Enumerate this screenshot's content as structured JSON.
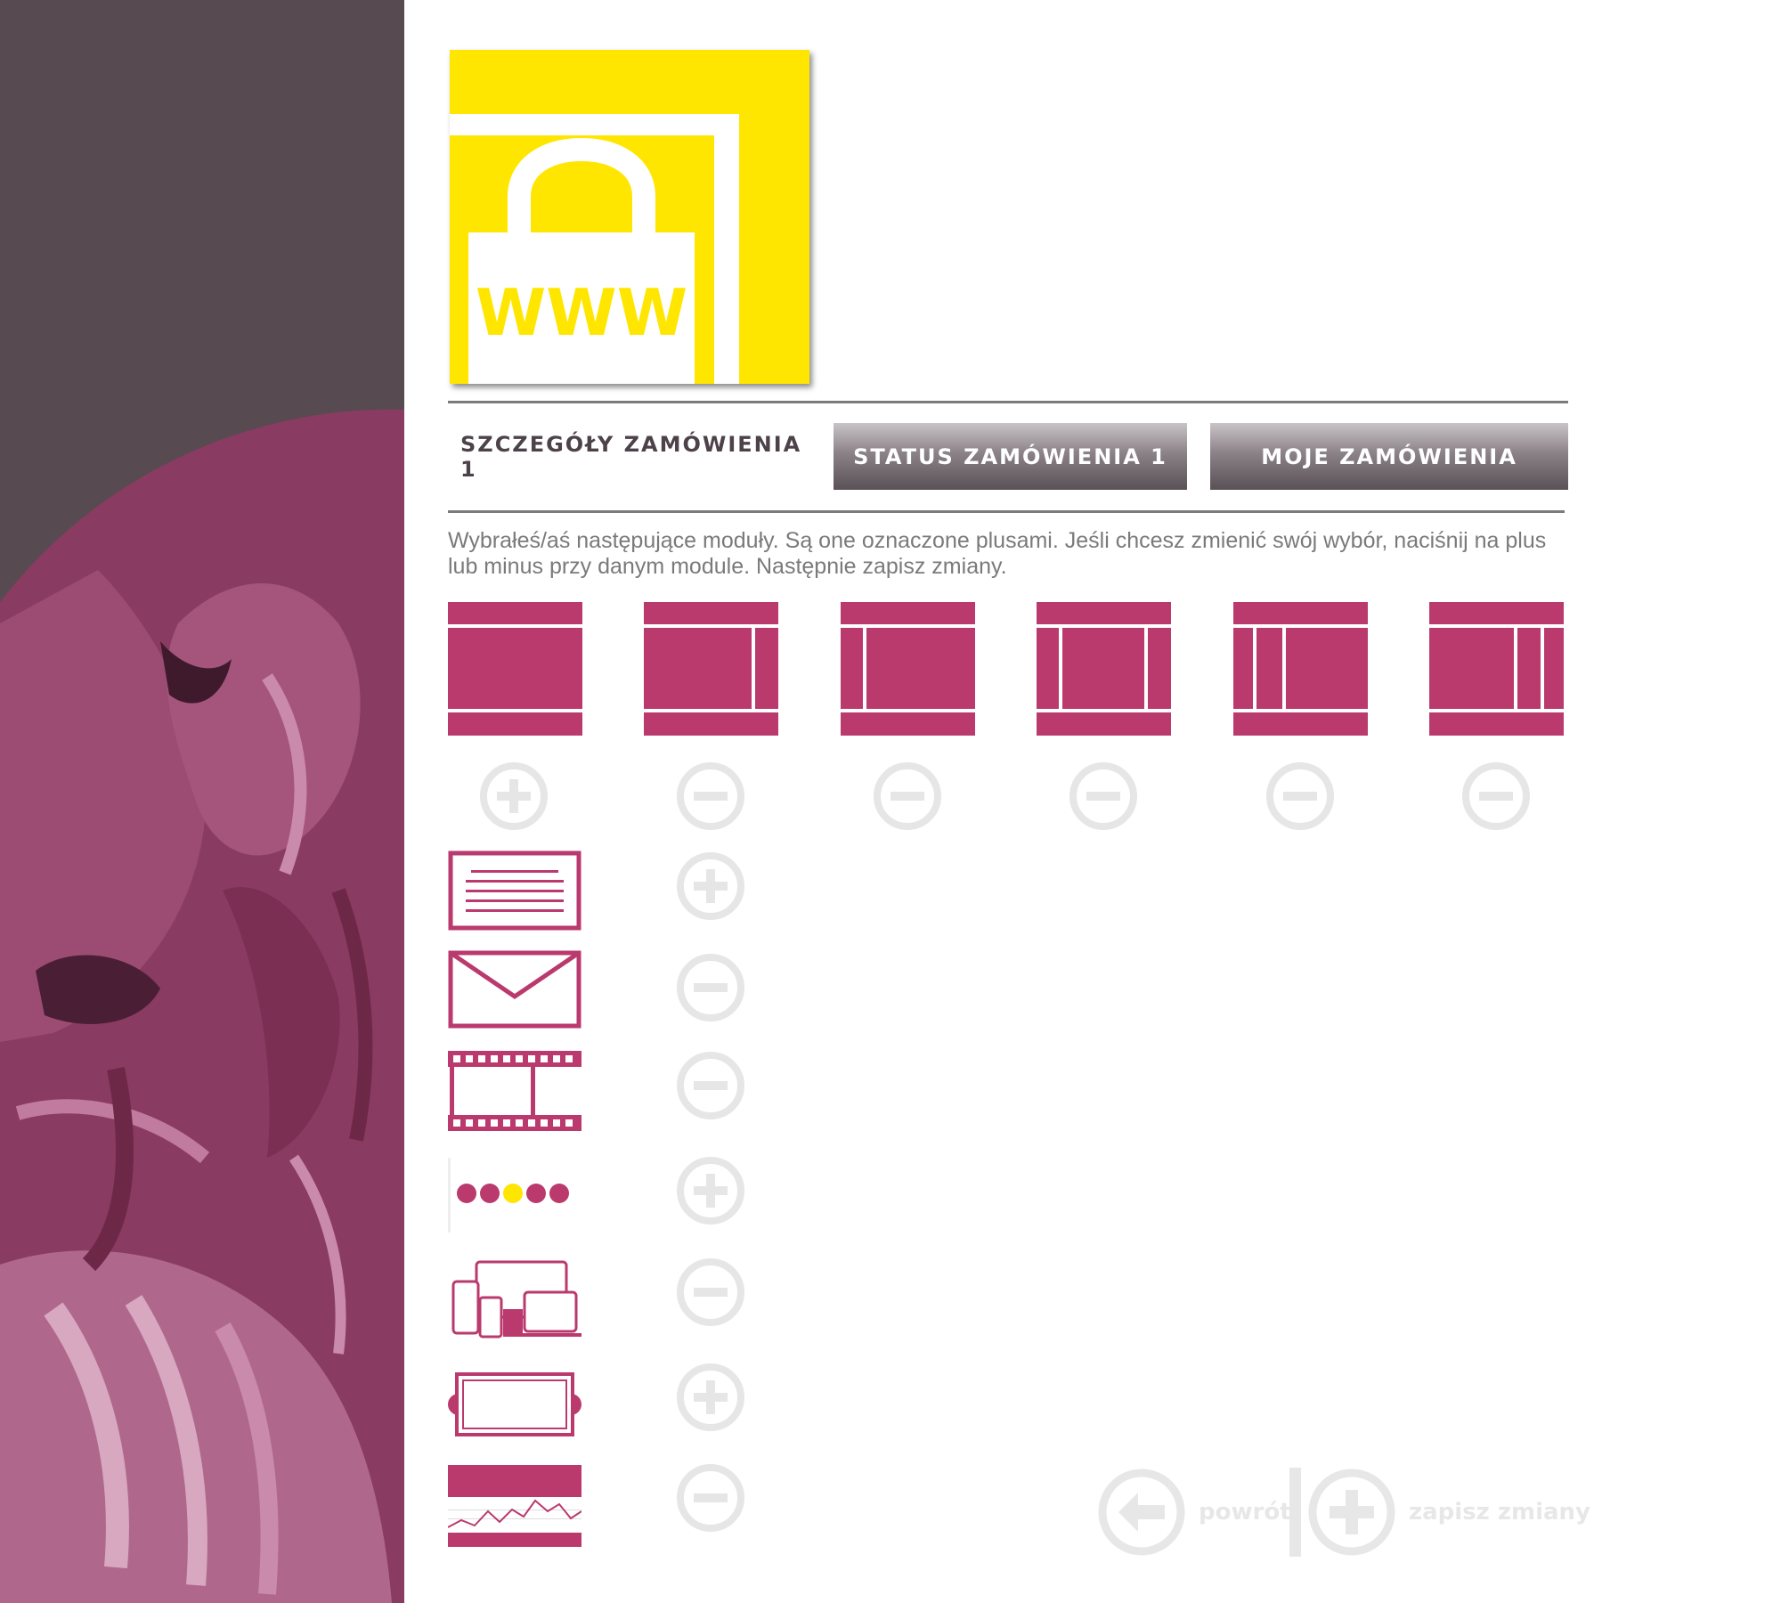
{
  "colors": {
    "accent": "#ba3a6e",
    "sidebar_dark": "#574a51",
    "logo_yellow": "#ffe600",
    "toggle_gray": "#e6e6e6",
    "text_gray": "#7a7a7a"
  },
  "logo": {
    "text": "WWW",
    "icon": "shopping-bag-www-icon"
  },
  "tabs": [
    {
      "label": "SZCZEGÓŁY ZAMÓWIENIA 1",
      "active": true
    },
    {
      "label": "STATUS ZAMÓWIENIA 1",
      "active": false
    },
    {
      "label": "MOJE ZAMÓWIENIA",
      "active": false
    }
  ],
  "intro_text": "Wybrałeś/aś następujące moduły. Są one oznaczone plusami. Jeśli chcesz zmienić swój wybór, naciśnij na plus lub minus przy danym module. Następnie zapisz zmiany.",
  "layouts": [
    {
      "icon": "layout-full-width-icon",
      "state": "plus"
    },
    {
      "icon": "layout-right-sidebar-icon",
      "state": "minus"
    },
    {
      "icon": "layout-left-sidebar-icon",
      "state": "minus"
    },
    {
      "icon": "layout-both-sidebars-icon",
      "state": "minus"
    },
    {
      "icon": "layout-two-left-sidebars-icon",
      "state": "minus"
    },
    {
      "icon": "layout-two-right-sidebars-icon",
      "state": "minus"
    }
  ],
  "modules": [
    {
      "icon": "text-document-icon",
      "state": "plus"
    },
    {
      "icon": "envelope-icon",
      "state": "minus"
    },
    {
      "icon": "film-strip-icon",
      "state": "minus"
    },
    {
      "icon": "slider-dots-icon",
      "state": "plus"
    },
    {
      "icon": "responsive-devices-icon",
      "state": "minus"
    },
    {
      "icon": "banner-frame-icon",
      "state": "plus"
    },
    {
      "icon": "statistics-chart-icon",
      "state": "minus"
    }
  ],
  "footer": {
    "back_label": "powrót",
    "save_label": "zapisz zmiany"
  }
}
